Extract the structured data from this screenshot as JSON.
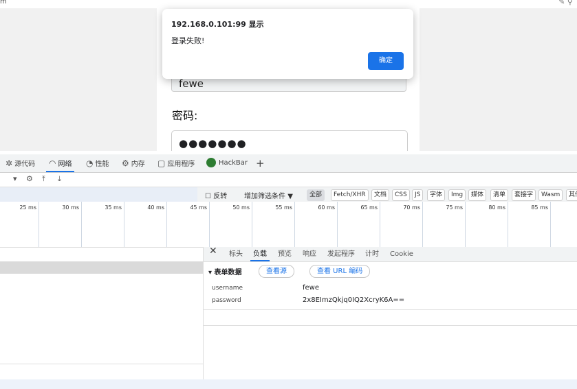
{
  "browser": {
    "title_glyph": "m",
    "tool_glyph": "✎ ⚲"
  },
  "page": {
    "username_value": "fewe",
    "password_label": "密码:",
    "password_value": "●●●●●●●"
  },
  "dialog": {
    "title": "192.168.0.101:99 显示",
    "message": "登录失败!",
    "ok_label": "确定"
  },
  "devtools": {
    "tabs": [
      {
        "label": "源代码",
        "icon": "bug-icon"
      },
      {
        "label": "网络",
        "icon": "wifi-icon"
      },
      {
        "label": "性能",
        "icon": "gauge-icon"
      },
      {
        "label": "内存",
        "icon": "gear-icon"
      },
      {
        "label": "应用程序",
        "icon": "window-icon"
      },
      {
        "label": "HackBar",
        "icon": "hackbar-logo"
      },
      {
        "label": "+",
        "icon": "plus-icon"
      }
    ],
    "active_tab": "网络",
    "filter": {
      "invert_label": "反转",
      "more_filters_label": "增加筛选条件",
      "chips": [
        "全部",
        "Fetch/XHR",
        "文档",
        "CSS",
        "JS",
        "字体",
        "Img",
        "媒体",
        "清单",
        "套接字",
        "Wasm",
        "其他"
      ],
      "selected_chip": "全部"
    },
    "timeline_ticks": [
      "25 ms",
      "30 ms",
      "35 ms",
      "40 ms",
      "45 ms",
      "50 ms",
      "55 ms",
      "60 ms",
      "65 ms",
      "70 ms",
      "75 ms",
      "80 ms",
      "85 ms"
    ],
    "detail_tabs": [
      "标头",
      "负载",
      "预览",
      "响应",
      "发起程序",
      "计时",
      "Cookie"
    ],
    "active_detail_tab": "负载",
    "payload": {
      "section_title": "▾ 表单数据",
      "view_source_label": "查看源",
      "view_url_encoded_label": "查看 URL 编码",
      "fields": [
        {
          "key": "username",
          "value": "fewe"
        },
        {
          "key": "password",
          "value": "2x8EImzQkjq0IQ2XcryK6A=="
        }
      ]
    }
  },
  "colors": {
    "accent": "#1a73e8",
    "devtools_bg": "#f1f3f4"
  }
}
